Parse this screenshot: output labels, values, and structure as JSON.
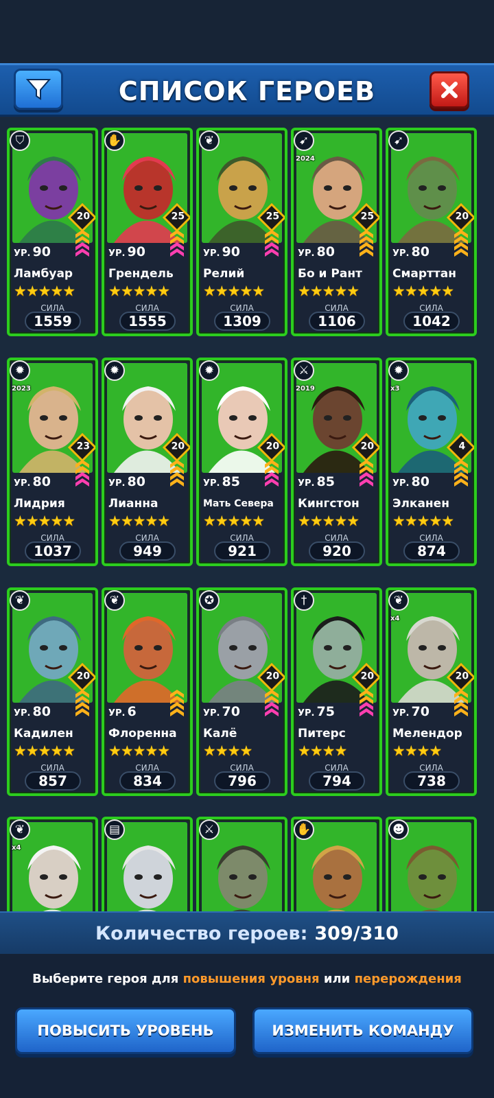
{
  "header": {
    "title": "СПИСОК ГЕРОЕВ"
  },
  "icons": {
    "filter": "filter-funnel-icon",
    "close": "close-x-icon"
  },
  "colors": {
    "card_border": "#2ccd1e",
    "accent_orange": "#ff9a2b",
    "button_blue": "#2a7fe0",
    "close_red": "#d8231d",
    "star": "#ffcc11"
  },
  "level_prefix": "УР.",
  "power_label": "СИЛА",
  "heroes": [
    {
      "name": "Ламбуар",
      "level": "90",
      "stars": "★★★★★",
      "power": "1559",
      "rank": "20",
      "class_icon": "shield-icon",
      "badge": "",
      "chevron_color": "pink"
    },
    {
      "name": "Грендель",
      "level": "90",
      "stars": "★★★★★",
      "power": "1555",
      "rank": "25",
      "class_icon": "hand-icon",
      "badge": "",
      "chevron_color": "pink"
    },
    {
      "name": "Релий",
      "level": "90",
      "stars": "★★★★★",
      "power": "1309",
      "rank": "25",
      "class_icon": "leaf-icon",
      "badge": "",
      "chevron_color": "pink"
    },
    {
      "name": "Бо и Рант",
      "level": "80",
      "stars": "★★★★★",
      "power": "1106",
      "rank": "25",
      "class_icon": "bow-icon",
      "badge": "2024",
      "chevron_color": "gold"
    },
    {
      "name": "Смарттан",
      "level": "80",
      "stars": "★★★★★",
      "power": "1042",
      "rank": "20",
      "class_icon": "bow-icon",
      "badge": "",
      "chevron_color": "gold"
    },
    {
      "name": "Лидрия",
      "level": "80",
      "stars": "★★★★★",
      "power": "1037",
      "rank": "23",
      "class_icon": "sun-icon",
      "badge": "2023",
      "chevron_color": "pink"
    },
    {
      "name": "Лианна",
      "level": "80",
      "stars": "★★★★★",
      "power": "949",
      "rank": "20",
      "class_icon": "sun-icon",
      "badge": "",
      "chevron_color": "gold"
    },
    {
      "name": "Мать Севера",
      "level": "85",
      "stars": "★★★★★",
      "power": "921",
      "rank": "20",
      "class_icon": "sun-icon",
      "badge": "",
      "chevron_color": "pink"
    },
    {
      "name": "Кингстон",
      "level": "85",
      "stars": "★★★★★",
      "power": "920",
      "rank": "20",
      "class_icon": "swords-icon",
      "badge": "2019",
      "chevron_color": "pink"
    },
    {
      "name": "Элканен",
      "level": "80",
      "stars": "★★★★★",
      "power": "874",
      "rank": "4",
      "class_icon": "sun-icon",
      "badge": "x3",
      "chevron_color": "gold"
    },
    {
      "name": "Кадилен",
      "level": "80",
      "stars": "★★★★★",
      "power": "857",
      "rank": "20",
      "class_icon": "leaf-icon",
      "badge": "",
      "chevron_color": "gold"
    },
    {
      "name": "Флоренна",
      "level": "6",
      "stars": "★★★★★",
      "power": "834",
      "rank": "",
      "class_icon": "leaf-icon",
      "badge": "",
      "chevron_color": "gold"
    },
    {
      "name": "Калё",
      "level": "70",
      "stars": "★★★★",
      "power": "796",
      "rank": "20",
      "class_icon": "pentagram-icon",
      "badge": "",
      "chevron_color": "pink"
    },
    {
      "name": "Питерс",
      "level": "75",
      "stars": "★★★★",
      "power": "794",
      "rank": "20",
      "class_icon": "dagger-icon",
      "badge": "",
      "chevron_color": "pink"
    },
    {
      "name": "Мелендор",
      "level": "70",
      "stars": "★★★★",
      "power": "738",
      "rank": "20",
      "class_icon": "leaf-icon",
      "badge": "x4",
      "chevron_color": "gold"
    },
    {
      "name": "",
      "level": "",
      "stars": "",
      "power": "",
      "rank": "",
      "class_icon": "leaf-icon",
      "badge": "x4",
      "chevron_color": "gold"
    },
    {
      "name": "",
      "level": "",
      "stars": "",
      "power": "",
      "rank": "",
      "class_icon": "book-icon",
      "badge": "",
      "chevron_color": "gold"
    },
    {
      "name": "",
      "level": "",
      "stars": "",
      "power": "",
      "rank": "",
      "class_icon": "swords-icon",
      "badge": "",
      "chevron_color": "gold"
    },
    {
      "name": "",
      "level": "",
      "stars": "",
      "power": "",
      "rank": "",
      "class_icon": "hand-icon",
      "badge": "",
      "chevron_color": "gold"
    },
    {
      "name": "",
      "level": "",
      "stars": "",
      "power": "",
      "rank": "",
      "class_icon": "goblin-icon",
      "badge": "",
      "chevron_color": "gold"
    }
  ],
  "footer": {
    "count_label": "Количество героев:",
    "count_value": "309/310",
    "hint_prefix": "Выберите героя для",
    "hint_accent1": "повышения уровня",
    "hint_mid": "или",
    "hint_accent2": "перерождения",
    "level_up_button": "ПОВЫСИТЬ УРОВЕНЬ",
    "change_team_button": "ИЗМЕНИТЬ КОМАНДУ"
  }
}
